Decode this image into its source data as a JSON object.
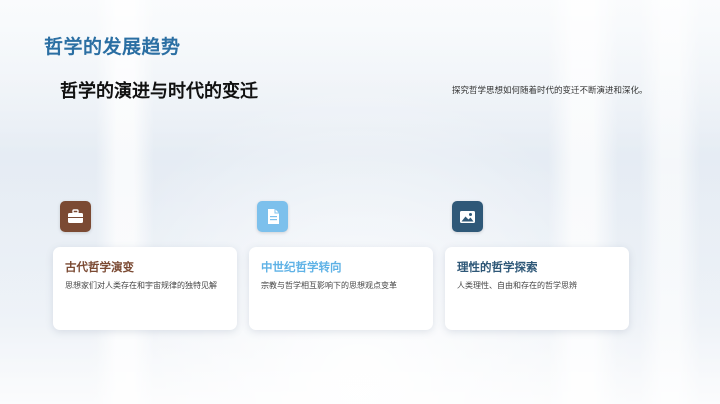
{
  "header": {
    "section_title": "哲学的发展趋势",
    "main_heading": "哲学的演进与时代的变迁",
    "description": "探究哲学思想如何随着时代的变迁不断演进和深化。"
  },
  "cards": [
    {
      "icon": "briefcase-icon",
      "icon_color": "#7b4a33",
      "title": "古代哲学演变",
      "text": "思想家们对人类存在和宇宙规律的独特见解"
    },
    {
      "icon": "document-icon",
      "icon_color": "#7cc0ec",
      "title": "中世纪哲学转向",
      "text": "宗教与哲学相互影响下的思想观点变革"
    },
    {
      "icon": "image-icon",
      "icon_color": "#2f5878",
      "title": "理性的哲学探索",
      "text": "人类理性、自由和存在的哲学思辨"
    }
  ]
}
